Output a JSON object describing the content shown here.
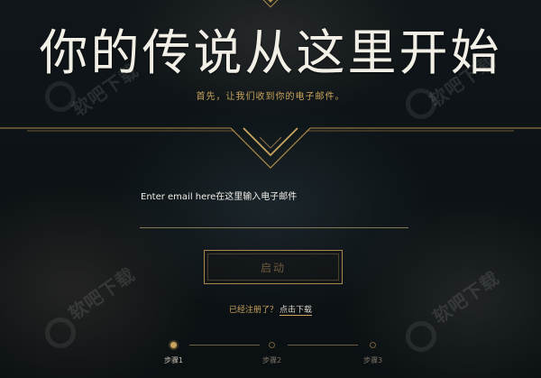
{
  "header": {
    "title": "你的传说从这里开始",
    "subtitle": "首先，让我们收到你的电子邮件。"
  },
  "form": {
    "email_label": "Enter email here在这里输入电子邮件",
    "email_value": "",
    "start_button_label": "启动"
  },
  "footer": {
    "registered_text": "已经注册了？",
    "download_link": "点击下载"
  },
  "steps": [
    {
      "label": "步骤1",
      "state": "active"
    },
    {
      "label": "步骤2",
      "state": "inactive"
    },
    {
      "label": "步骤3",
      "state": "inactive"
    }
  ],
  "watermark": {
    "text": "软吧下载"
  },
  "colors": {
    "accent_gold": "#c9a45d",
    "title_white": "#f2efe6",
    "background_dark": "#0c1114"
  }
}
